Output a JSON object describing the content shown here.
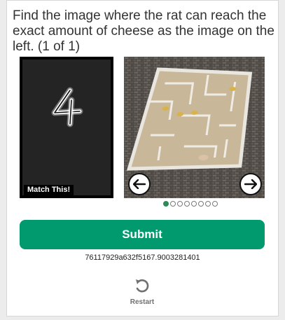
{
  "prompt": {
    "text": "Find the image where the rat can reach the exact amount of cheese as the image on the left. (1 of 1)"
  },
  "reference": {
    "digit": "4",
    "label": "Match This!"
  },
  "carousel": {
    "prev_icon": "arrow-left-icon",
    "next_icon": "arrow-right-icon",
    "page_count": 8,
    "active_index": 0
  },
  "submit": {
    "label": "Submit"
  },
  "session_id": "76117929a632f5167.9003281401",
  "restart": {
    "label": "Restart",
    "icon": "restart-icon"
  },
  "colors": {
    "accent": "#009a6e",
    "dot_active": "#2e8b57",
    "text": "#333333"
  }
}
